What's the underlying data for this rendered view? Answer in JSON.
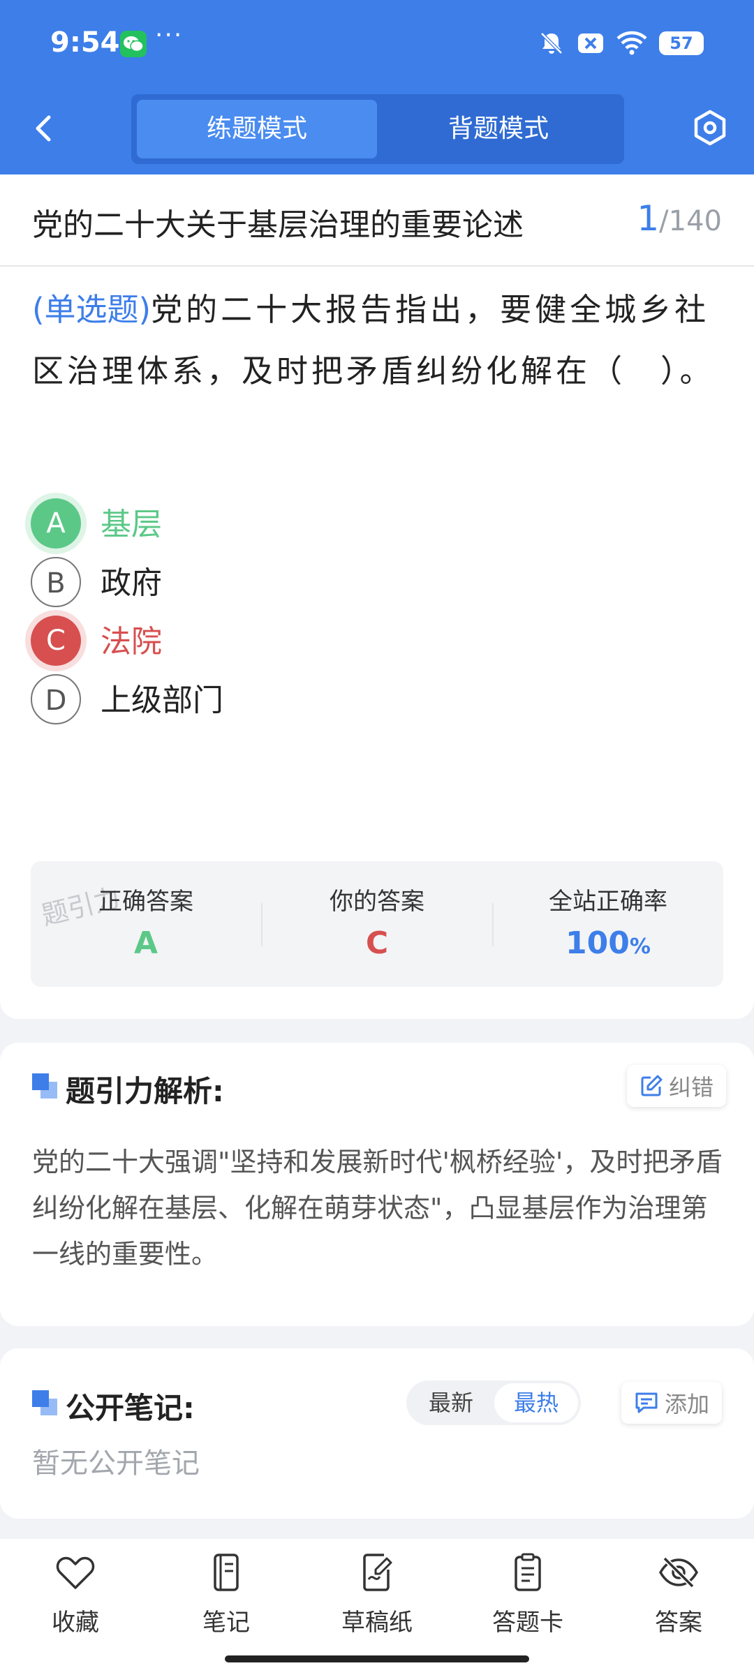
{
  "status_bar": {
    "time": "9:54",
    "more": "···",
    "battery": "57"
  },
  "header": {
    "tabs": [
      "练题模式",
      "背题模式"
    ],
    "active_tab": 0
  },
  "quiz": {
    "chapter_title": "党的二十大关于基层治理的重要论述",
    "progress_current": "1",
    "progress_total": "/140",
    "question_type": "(单选题)",
    "question_text": "党的二十大报告指出，要健全城乡社区治理体系，及时把矛盾纠纷化解在（　）。",
    "options": [
      {
        "letter": "A",
        "text": "基层",
        "state": "correct"
      },
      {
        "letter": "B",
        "text": "政府",
        "state": "normal"
      },
      {
        "letter": "C",
        "text": "法院",
        "state": "wrong"
      },
      {
        "letter": "D",
        "text": "上级部门",
        "state": "normal"
      }
    ]
  },
  "answer_summary": {
    "watermark": "题引力",
    "correct_label": "正确答案",
    "correct_value": "A",
    "your_label": "你的答案",
    "your_value": "C",
    "rate_label": "全站正确率",
    "rate_value": "100",
    "rate_unit": "%"
  },
  "analysis": {
    "title": "题引力解析:",
    "report_label": "纠错",
    "text": "党的二十大强调\"坚持和发展新时代'枫桥经验'，及时把矛盾纠纷化解在基层、化解在萌芽状态\"，凸显基层作为治理第一线的重要性。"
  },
  "notes": {
    "title": "公开笔记:",
    "sort_options": [
      "最新",
      "最热"
    ],
    "add_label": "添加",
    "empty_text": "暂无公开笔记"
  },
  "bottom_nav": {
    "favorite": "收藏",
    "note": "笔记",
    "draft": "草稿纸",
    "answer_card": "答题卡",
    "answer": "答案"
  },
  "colors": {
    "primary": "#3d7ee9",
    "correct": "#5cc888",
    "wrong": "#d74f4f"
  }
}
